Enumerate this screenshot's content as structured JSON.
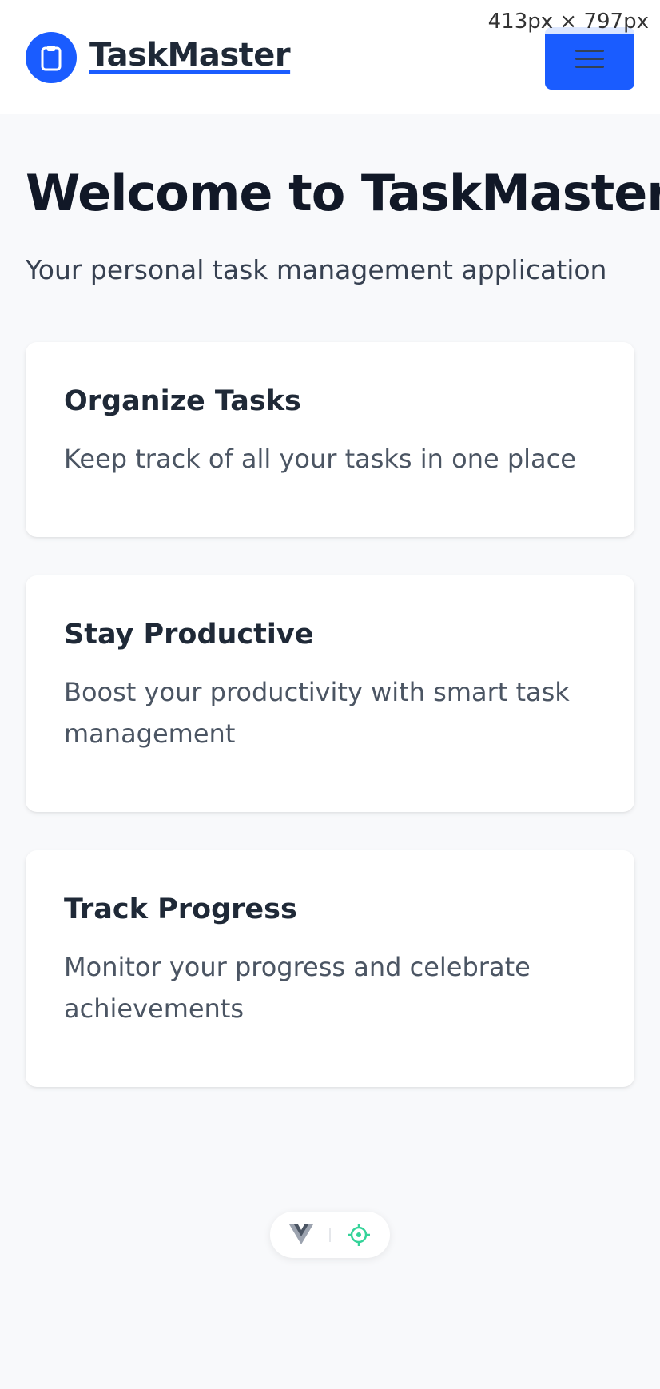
{
  "header": {
    "app_name": "TaskMaster",
    "logo_icon": "clipboard-icon",
    "menu_icon": "hamburger-menu-icon",
    "brand_color": "#1a5cff",
    "viewport_readout": "413px × 797px"
  },
  "hero": {
    "title": "Welcome to TaskMaster",
    "subtitle": "Your personal task management application"
  },
  "features": [
    {
      "title": "Organize Tasks",
      "description": "Keep track of all your tasks in one place"
    },
    {
      "title": "Stay Productive",
      "description": "Boost your productivity with smart task management"
    },
    {
      "title": "Track Progress",
      "description": "Monitor your progress and celebrate achievements"
    }
  ],
  "devtools": {
    "icons": [
      "vue-logo-icon",
      "crosshair-target-icon"
    ],
    "accent_color": "#34d399"
  }
}
